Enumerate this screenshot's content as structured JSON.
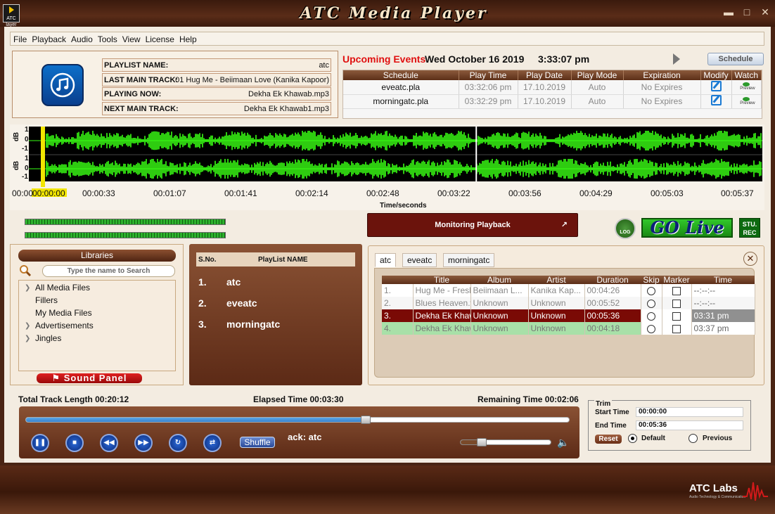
{
  "window": {
    "title": "ATC Media Player",
    "logo_text": "ATC\nlayer"
  },
  "menu": [
    "File",
    "Playback",
    "Audio",
    "Tools",
    "View",
    "License",
    "Help"
  ],
  "info": {
    "playlist_name_label": "PLAYLIST NAME:",
    "playlist_name": "atc",
    "last_main_track_label": "LAST MAIN TRACK:",
    "last_main_track": "01 Hug Me - Beiimaan Love (Kanika Kapoor)",
    "playing_now_label": "PLAYING NOW:",
    "playing_now": "Dekha Ek Khawab.mp3",
    "next_main_track_label": "NEXT MAIN TRACK:",
    "next_main_track": "Dekha Ek Khawab1.mp3"
  },
  "events": {
    "label": "Upcoming Events",
    "date": "Wed October 16 2019",
    "time": "3:33:07 pm",
    "schedule_button": "Schedule",
    "columns": [
      "Schedule",
      "Play Time",
      "Play Date",
      "Play Mode",
      "Expiration",
      "Modify",
      "Watch"
    ],
    "rows": [
      {
        "schedule": "eveatc.pla",
        "play_time": "03:32:06 pm",
        "play_date": "17.10.2019",
        "mode": "Auto",
        "expiration": "No Expires"
      },
      {
        "schedule": "morningatc.pla",
        "play_time": "03:32:29 pm",
        "play_date": "17.10.2019",
        "mode": "Auto",
        "expiration": "No Expires"
      }
    ],
    "watch_label": "Preview"
  },
  "waveform": {
    "db_label": "dB",
    "db_ticks": [
      "1",
      "0",
      "-1"
    ],
    "time_ticks": [
      "00:00",
      "00:00:33",
      "00:01:07",
      "00:01:41",
      "00:02:14",
      "00:02:48",
      "00:03:22",
      "00:03:56",
      "00:04:29",
      "00:05:03",
      "00:05:37"
    ],
    "cursor_time": "00:00:00",
    "axis_label": "Time/seconds",
    "playhead_fraction": 0.61
  },
  "monitor": {
    "label": "Monitoring Playback"
  },
  "buttons": {
    "log": "LOG",
    "go_live": "GO Live",
    "stu_rec": "STU.\nREC"
  },
  "libraries": {
    "title": "Libraries",
    "search_placeholder": "Type the name to Search",
    "items": [
      {
        "label": "All Media Files",
        "expandable": true
      },
      {
        "label": "Fillers",
        "expandable": false
      },
      {
        "label": "My Media Files",
        "expandable": false
      },
      {
        "label": "Advertisements",
        "expandable": true
      },
      {
        "label": "Jingles",
        "expandable": true
      }
    ],
    "sound_panel": "Sound Panel"
  },
  "playlists": {
    "col_sno": "S.No.",
    "col_name": "PlayList NAME",
    "items": [
      {
        "num": "1.",
        "name": "atc"
      },
      {
        "num": "2.",
        "name": "eveatc"
      },
      {
        "num": "3.",
        "name": "morningatc"
      }
    ]
  },
  "tracks": {
    "tabs": [
      "atc",
      "eveatc",
      "morningatc"
    ],
    "active_tab": "atc",
    "columns": [
      "Title",
      "Album",
      "Artist",
      "Duration",
      "Skip",
      "Marker",
      "Time"
    ],
    "rows": [
      {
        "no": "1.",
        "title": "Hug Me - Fresh...",
        "album": "Beiimaan L...",
        "artist": "Kanika Kap...",
        "duration": "00:04:26",
        "time": "--:--:--",
        "state": "played"
      },
      {
        "no": "2.",
        "title": "Blues Heaven.w...",
        "album": "Unknown",
        "artist": "Unknown",
        "duration": "00:05:52",
        "time": "--:--:--",
        "state": "played"
      },
      {
        "no": "3.",
        "title": "Dekha Ek Khawab",
        "album": "Unknown",
        "artist": "Unknown",
        "duration": "00:05:36",
        "time": "03:31 pm",
        "state": "playing"
      },
      {
        "no": "4.",
        "title": "Dekha Ek Khaw...",
        "album": "Unknown",
        "artist": "Unknown",
        "duration": "00:04:18",
        "time": "03:37 pm",
        "state": "next"
      }
    ]
  },
  "transport": {
    "total_label": "Total Track Length 00:20:12",
    "elapsed_label": "Elapsed Time 00:03:30",
    "remaining_label": "Remaining Time 00:02:06",
    "progress_fraction": 0.625,
    "shuffle": "Shuffle",
    "track_text": "ack: atc",
    "volume_fraction": 0.24
  },
  "trim": {
    "title": "Trim",
    "start_label": "Start Time",
    "start_value": "00:00:00",
    "end_label": "End Time",
    "end_value": "00:05:36",
    "reset": "Reset",
    "default_label": "Default",
    "previous_label": "Previous",
    "selected": "default"
  },
  "footer": {
    "brand": "ATC Labs",
    "tagline": "Audio Technology & Communication"
  },
  "colors": {
    "accent": "#5c2a16",
    "waveform": "#39ff14",
    "alert": "#e01010"
  }
}
